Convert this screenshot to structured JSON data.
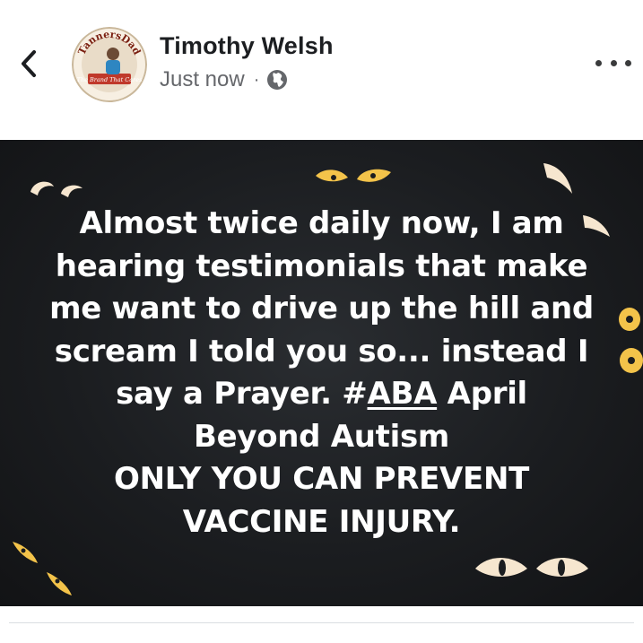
{
  "post": {
    "author": "Timothy Welsh",
    "timestamp": "Just now",
    "separator": "·",
    "audience_icon": "globe-icon",
    "avatar": {
      "top_text": "TannersDad",
      "bottom_text": "The Brand That Cares"
    },
    "image_text": {
      "line1": "Almost twice daily now, I am",
      "line2": "hearing testimonials that make",
      "line3": "me want to drive up the hill and",
      "line4": "scream I told you so... instead I",
      "line5_prefix": "say a Prayer.  #",
      "line5_hashtag": "ABA",
      "line5_suffix": " April",
      "line6": "Beyond Autism",
      "line7": "ONLY YOU CAN PREVENT",
      "line8": "VACCINE INJURY."
    }
  },
  "icons": {
    "back": "chevron-left-icon",
    "more": "more-options-icon"
  },
  "colors": {
    "image_background": "#1b1d20",
    "eye_color": "#f3c34a",
    "eye_light": "#f6e6cf",
    "text_dark": "#1c1e21",
    "text_muted": "#65676b"
  }
}
